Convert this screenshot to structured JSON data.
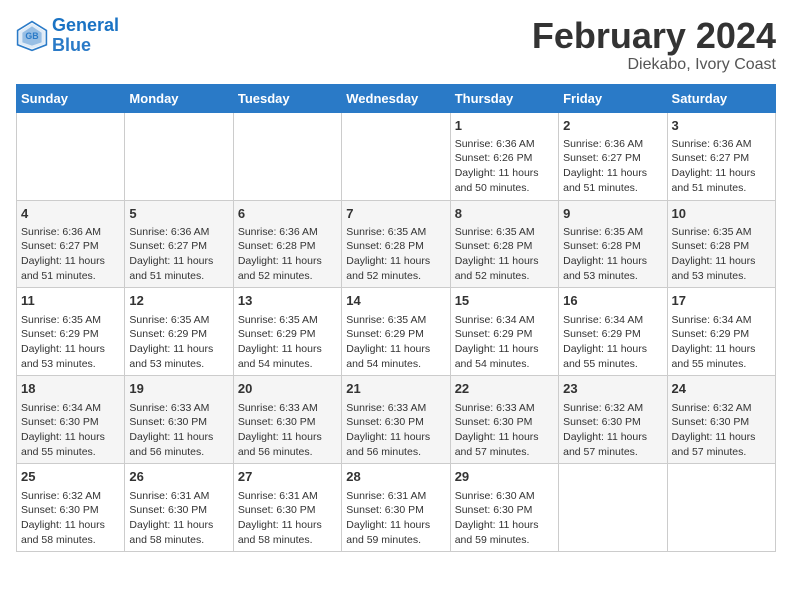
{
  "logo": {
    "line1": "General",
    "line2": "Blue"
  },
  "title": "February 2024",
  "subtitle": "Diekabo, Ivory Coast",
  "days_of_week": [
    "Sunday",
    "Monday",
    "Tuesday",
    "Wednesday",
    "Thursday",
    "Friday",
    "Saturday"
  ],
  "weeks": [
    [
      {
        "day": "",
        "info": ""
      },
      {
        "day": "",
        "info": ""
      },
      {
        "day": "",
        "info": ""
      },
      {
        "day": "",
        "info": ""
      },
      {
        "day": "1",
        "info": "Sunrise: 6:36 AM\nSunset: 6:26 PM\nDaylight: 11 hours and 50 minutes."
      },
      {
        "day": "2",
        "info": "Sunrise: 6:36 AM\nSunset: 6:27 PM\nDaylight: 11 hours and 51 minutes."
      },
      {
        "day": "3",
        "info": "Sunrise: 6:36 AM\nSunset: 6:27 PM\nDaylight: 11 hours and 51 minutes."
      }
    ],
    [
      {
        "day": "4",
        "info": "Sunrise: 6:36 AM\nSunset: 6:27 PM\nDaylight: 11 hours and 51 minutes."
      },
      {
        "day": "5",
        "info": "Sunrise: 6:36 AM\nSunset: 6:27 PM\nDaylight: 11 hours and 51 minutes."
      },
      {
        "day": "6",
        "info": "Sunrise: 6:36 AM\nSunset: 6:28 PM\nDaylight: 11 hours and 52 minutes."
      },
      {
        "day": "7",
        "info": "Sunrise: 6:35 AM\nSunset: 6:28 PM\nDaylight: 11 hours and 52 minutes."
      },
      {
        "day": "8",
        "info": "Sunrise: 6:35 AM\nSunset: 6:28 PM\nDaylight: 11 hours and 52 minutes."
      },
      {
        "day": "9",
        "info": "Sunrise: 6:35 AM\nSunset: 6:28 PM\nDaylight: 11 hours and 53 minutes."
      },
      {
        "day": "10",
        "info": "Sunrise: 6:35 AM\nSunset: 6:28 PM\nDaylight: 11 hours and 53 minutes."
      }
    ],
    [
      {
        "day": "11",
        "info": "Sunrise: 6:35 AM\nSunset: 6:29 PM\nDaylight: 11 hours and 53 minutes."
      },
      {
        "day": "12",
        "info": "Sunrise: 6:35 AM\nSunset: 6:29 PM\nDaylight: 11 hours and 53 minutes."
      },
      {
        "day": "13",
        "info": "Sunrise: 6:35 AM\nSunset: 6:29 PM\nDaylight: 11 hours and 54 minutes."
      },
      {
        "day": "14",
        "info": "Sunrise: 6:35 AM\nSunset: 6:29 PM\nDaylight: 11 hours and 54 minutes."
      },
      {
        "day": "15",
        "info": "Sunrise: 6:34 AM\nSunset: 6:29 PM\nDaylight: 11 hours and 54 minutes."
      },
      {
        "day": "16",
        "info": "Sunrise: 6:34 AM\nSunset: 6:29 PM\nDaylight: 11 hours and 55 minutes."
      },
      {
        "day": "17",
        "info": "Sunrise: 6:34 AM\nSunset: 6:29 PM\nDaylight: 11 hours and 55 minutes."
      }
    ],
    [
      {
        "day": "18",
        "info": "Sunrise: 6:34 AM\nSunset: 6:30 PM\nDaylight: 11 hours and 55 minutes."
      },
      {
        "day": "19",
        "info": "Sunrise: 6:33 AM\nSunset: 6:30 PM\nDaylight: 11 hours and 56 minutes."
      },
      {
        "day": "20",
        "info": "Sunrise: 6:33 AM\nSunset: 6:30 PM\nDaylight: 11 hours and 56 minutes."
      },
      {
        "day": "21",
        "info": "Sunrise: 6:33 AM\nSunset: 6:30 PM\nDaylight: 11 hours and 56 minutes."
      },
      {
        "day": "22",
        "info": "Sunrise: 6:33 AM\nSunset: 6:30 PM\nDaylight: 11 hours and 57 minutes."
      },
      {
        "day": "23",
        "info": "Sunrise: 6:32 AM\nSunset: 6:30 PM\nDaylight: 11 hours and 57 minutes."
      },
      {
        "day": "24",
        "info": "Sunrise: 6:32 AM\nSunset: 6:30 PM\nDaylight: 11 hours and 57 minutes."
      }
    ],
    [
      {
        "day": "25",
        "info": "Sunrise: 6:32 AM\nSunset: 6:30 PM\nDaylight: 11 hours and 58 minutes."
      },
      {
        "day": "26",
        "info": "Sunrise: 6:31 AM\nSunset: 6:30 PM\nDaylight: 11 hours and 58 minutes."
      },
      {
        "day": "27",
        "info": "Sunrise: 6:31 AM\nSunset: 6:30 PM\nDaylight: 11 hours and 58 minutes."
      },
      {
        "day": "28",
        "info": "Sunrise: 6:31 AM\nSunset: 6:30 PM\nDaylight: 11 hours and 59 minutes."
      },
      {
        "day": "29",
        "info": "Sunrise: 6:30 AM\nSunset: 6:30 PM\nDaylight: 11 hours and 59 minutes."
      },
      {
        "day": "",
        "info": ""
      },
      {
        "day": "",
        "info": ""
      }
    ]
  ]
}
